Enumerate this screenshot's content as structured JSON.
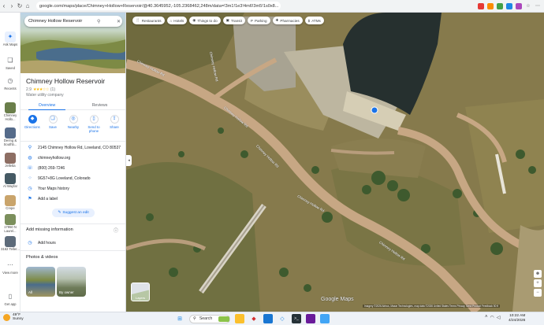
{
  "browser": {
    "url": "google.com/maps/place/Chimney+Hollow+Reservoir/@40.3645952,-105.2368462,248m/data=!3m1!1e3!4m6!3m5!1s0x8..."
  },
  "rail": {
    "items": [
      {
        "label": "Ask Maps"
      },
      {
        "label": "Saved"
      },
      {
        "label": "Recents"
      },
      {
        "label": "Chimney Hollo..."
      },
      {
        "label": "Dering & Southb..."
      },
      {
        "label": "Jelletta"
      },
      {
        "label": "Al Wayfar"
      },
      {
        "label": "Crepe"
      },
      {
        "label": "17950 N Laurel..."
      },
      {
        "label": "3162 Teller..."
      },
      {
        "label": "View more"
      },
      {
        "label": "Get app"
      }
    ]
  },
  "panel": {
    "search_value": "Chimney Hollow Reservoir",
    "title": "Chimney Hollow Reservoir",
    "rating": "2.9",
    "stars": "★★★☆☆",
    "review_count": "(1)",
    "category": "Water utility company",
    "tabs": [
      {
        "label": "Overview"
      },
      {
        "label": "Reviews"
      }
    ],
    "actions": [
      {
        "label": "Directions"
      },
      {
        "label": "Save"
      },
      {
        "label": "Nearby"
      },
      {
        "label": "Send to phone"
      },
      {
        "label": "Share"
      }
    ],
    "info": {
      "address": "2145 Chimney Hollow Rd, Loveland, CO 80537",
      "website": "chimneyhollow.org",
      "phone": "(800) 269-7246",
      "plus_code": "9G57+8G Loveland, Colorado",
      "history": "Your Maps history",
      "label": "Add a label"
    },
    "suggest_edit": "Suggest an edit",
    "missing_info": "Add missing information",
    "add_hours": "Add hours",
    "photos_head": "Photos & videos",
    "photos": [
      {
        "label": "All"
      },
      {
        "label": "By owner"
      }
    ]
  },
  "map": {
    "chips": [
      {
        "label": "Restaurants"
      },
      {
        "label": "Hotels"
      },
      {
        "label": "Things to do"
      },
      {
        "label": "Transit"
      },
      {
        "label": "Parking"
      },
      {
        "label": "Pharmacies"
      },
      {
        "label": "ATMs"
      }
    ],
    "street_labels": {
      "a": "Chimney Hollow Rd",
      "b": "Chimney Hollow Rd",
      "c": "Chimney Hollow Rd",
      "d": "Chimney Hollow Rd",
      "e": "Chimney Hollow Rd",
      "f": "Chimney Hollow Rd"
    },
    "layers_label": "Layers",
    "logo": "Google Maps",
    "attribution": "Imagery ©2026 Airbus, Maxar Technologies, map data ©2026  United States  Terms  Privacy  Send Product Feedback  50 ft"
  },
  "taskbar": {
    "temp": "49°F",
    "weather": "Sunny",
    "search": "Search",
    "time": "10:22 AM",
    "date": "4/24/2026"
  }
}
